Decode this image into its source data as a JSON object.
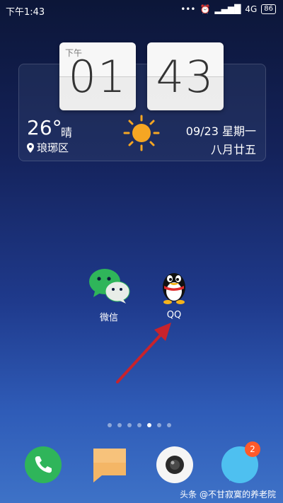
{
  "status_bar": {
    "time": "下午1:43",
    "network": "4G",
    "battery": "86"
  },
  "clock_widget": {
    "ampm": "下午",
    "hour": "01",
    "minute": "43",
    "temperature": "26°",
    "condition": "晴",
    "location": "琅琊区",
    "date": "09/23 星期一",
    "lunar_date": "八月廿五"
  },
  "apps": [
    {
      "label": "微信",
      "icon": "wechat-icon"
    },
    {
      "label": "QQ",
      "icon": "qq-penguin-icon"
    }
  ],
  "page_indicator": {
    "count": 7,
    "active": 4
  },
  "dock": [
    {
      "icon": "phone-icon"
    },
    {
      "icon": "messages-icon"
    },
    {
      "icon": "camera-icon"
    },
    {
      "icon": "chat-bubble-icon",
      "badge": "2"
    }
  ],
  "watermark": "头条 @不甘寂寞的养老院",
  "colors": {
    "accent_green": "#2fb55a",
    "sun": "#f5a623",
    "badge": "#ff5a2a"
  }
}
